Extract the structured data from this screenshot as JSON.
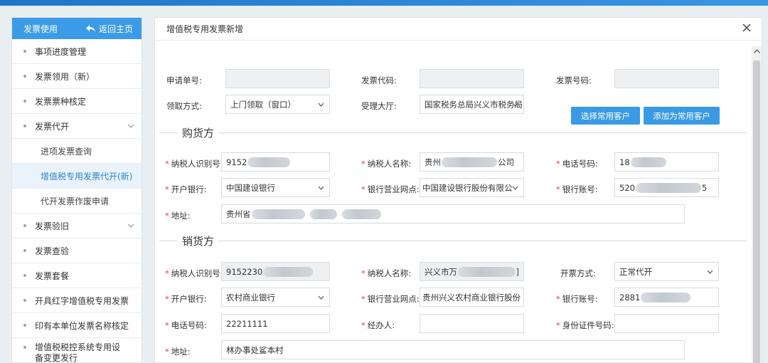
{
  "sidebar": {
    "header_title": "发票使用",
    "home_label": "返回主页",
    "items": [
      {
        "label": "事项进度管理"
      },
      {
        "label": "发票领用（新）"
      },
      {
        "label": "发票票种核定"
      },
      {
        "label": "发票代开"
      },
      {
        "label": "进项发票查询"
      },
      {
        "label": "增值税专用发票代开(新)"
      },
      {
        "label": "代开发票作废申请"
      },
      {
        "label": "发票验旧"
      },
      {
        "label": "发票查验"
      },
      {
        "label": "发票套餐"
      },
      {
        "label": "开具红字增值税专用发票"
      },
      {
        "label": "印有本单位发票名称核定"
      },
      {
        "label": "增值税税控系统专用设备变更发行"
      }
    ]
  },
  "dialog": {
    "title": "增值税专用发票新增",
    "top": {
      "apply_no_label": "申请单号:",
      "invoice_code_label": "发票代码:",
      "invoice_no_label": "发票号码:",
      "pickup_label": "领取方式:",
      "pickup_value": "上门领取（窗口）",
      "hall_label": "受理大厅:",
      "hall_value": "国家税务总局兴义市税务局",
      "btn_select_customer": "选择常用客户",
      "btn_add_customer": "添加为常用客户"
    },
    "buyer": {
      "section_title": "购货方",
      "tax_id_label": "纳税人识别号:",
      "tax_id_value": "9152",
      "name_label": "纳税人名称:",
      "name_prefix": "贵州",
      "name_suffix": "公司",
      "phone_label": "电话号码:",
      "phone_value": "18",
      "bank_label": "开户银行:",
      "bank_value": "中国建设银行",
      "branch_label": "银行营业网点:",
      "branch_value": "中国建设银行股份有限公",
      "account_label": "银行账号:",
      "account_prefix": "520",
      "account_suffix": "5",
      "address_label": "地址:",
      "address_value": "贵州省"
    },
    "seller": {
      "section_title": "销货方",
      "tax_id_label": "纳税人识别号:",
      "tax_id_value": "9152230",
      "name_label": "纳税人名称:",
      "name_value": "兴义市万",
      "name_suffix": "]",
      "invoice_mode_label": "开票方式:",
      "invoice_mode_value": "正常代开",
      "bank_label": "开户银行:",
      "bank_value": "农村商业银行",
      "branch_label": "银行营业网点:",
      "branch_value": "贵州兴义农村商业银行股份",
      "account_label": "银行账号:",
      "account_value": "2881",
      "phone_label": "电话号码:",
      "phone_value": "22211111",
      "handler_label": "经办人:",
      "id_no_label": "身份证件号码:",
      "address_label": "地址:",
      "address_value": "林办事处鲨本村"
    }
  },
  "colors": {
    "accent": "#3a9ae5",
    "required": "#e14343",
    "active_bg": "#eaf3fc"
  }
}
